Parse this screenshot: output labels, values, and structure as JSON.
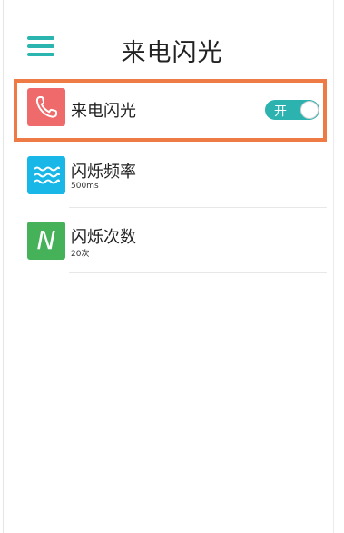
{
  "header": {
    "title": "来电闪光",
    "menu_icon": "hamburger-menu-icon",
    "accent_color": "#2bb5b0"
  },
  "settings": [
    {
      "id": "incoming-call-flash",
      "title": "来电闪光",
      "icon": "phone-icon",
      "icon_color": "#ef6a6a",
      "toggle_label": "开",
      "toggle_on": true,
      "highlighted": true,
      "highlight_color": "#ee7a46"
    },
    {
      "id": "flash-frequency",
      "title": "闪烁频率",
      "value": "500ms",
      "icon": "wave-icon",
      "icon_color": "#18b7e8"
    },
    {
      "id": "flash-count",
      "title": "闪烁次数",
      "value": "20次",
      "icon": "letter-n-icon",
      "icon_glyph": "N",
      "icon_color": "#45b25a"
    }
  ]
}
